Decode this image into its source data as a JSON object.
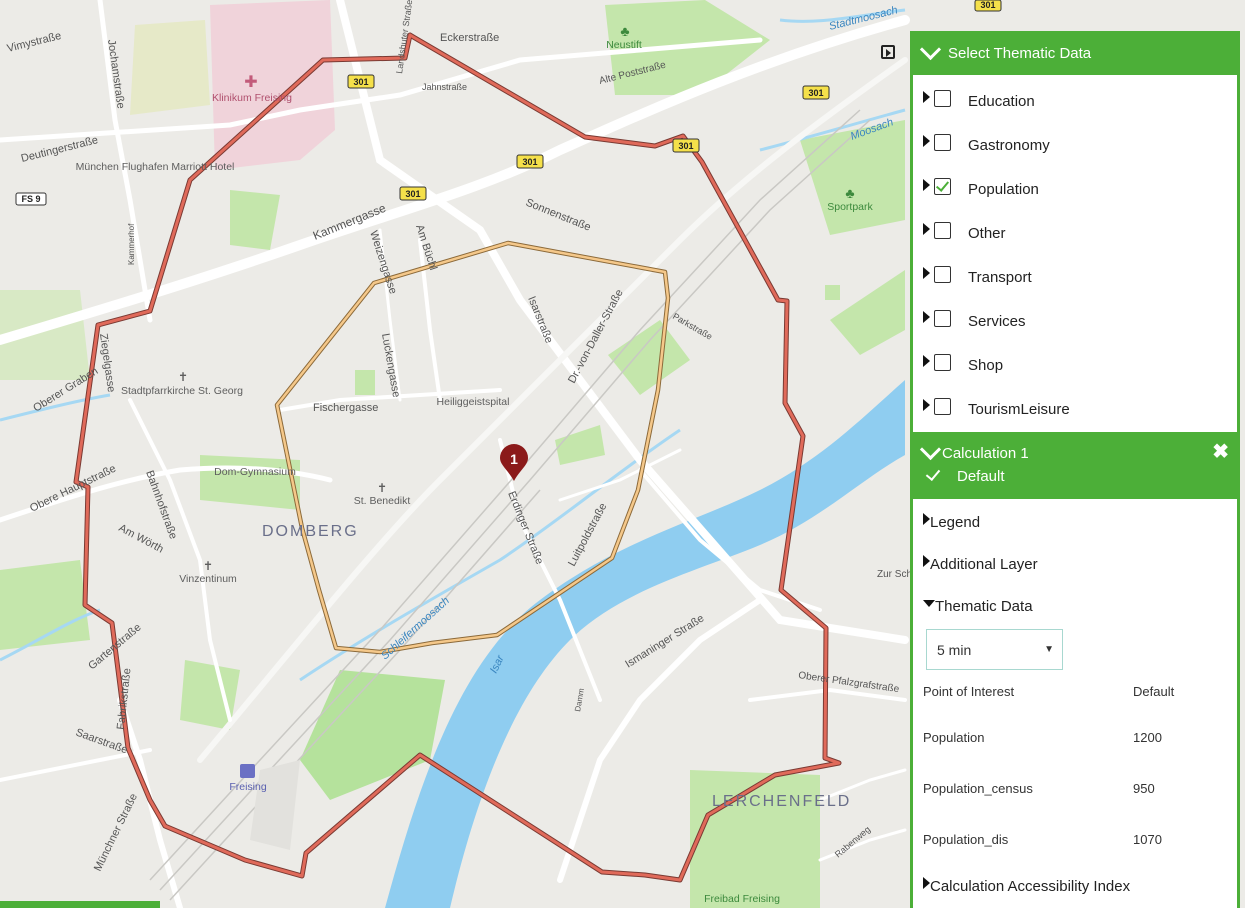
{
  "map": {
    "street_labels": [
      "Vimystraße",
      "Jochamstraße",
      "Deutingerstraße",
      "Kammergasse",
      "Weizengasse",
      "Am Büchl",
      "Sonnenstraße",
      "Isarstraße",
      "Dr.-von-Daller-Straße",
      "Parkstraße",
      "Luckengasse",
      "Fischergasse",
      "Erdinger Straße",
      "Luitpoldstraße",
      "Schleifermoosach",
      "Ziegelgasse",
      "Oberer Graben",
      "Obere Hauptstraße",
      "Bahnhofstraße",
      "Am Wörth",
      "Gartenstraße",
      "Fabrikstraße",
      "Saarstraße",
      "Münchner Straße",
      "Ismaninger Straße",
      "Oberer Pfalzgrafstraße",
      "Rabenweg",
      "Eckerstraße",
      "Jahnstraße",
      "Alte Poststraße",
      "Landshuter Straße",
      "Kammerhof",
      "Damm",
      "Isar",
      "Stadtmoosach",
      "Moosach",
      "Zur Schleife"
    ],
    "poi_labels": [
      "Klinikum Freising",
      "München Flughafen Marriott Hotel",
      "Neustift",
      "Sportpark",
      "Stadtpfarrkirche St. Georg",
      "Heiliggeistspital",
      "Dom-Gymnasium",
      "St. Benedikt",
      "Vinzentinum",
      "Freising",
      "Freibad Freising"
    ],
    "area_labels": [
      "DOMBERG",
      "LERCHENFELD"
    ],
    "road_badges": [
      "301",
      "301",
      "301",
      "301",
      "301",
      "301",
      "FS 9"
    ],
    "marker_number": "1",
    "colors": {
      "isochrone_outer": "#d9685a",
      "isochrone_inner": "#f2c180",
      "river": "#8fcdf0",
      "park": "#b9e5a0",
      "marker": "#8b1a1a"
    }
  },
  "panel": {
    "header_title": "Select Thematic Data",
    "thematic_items": [
      {
        "label": "Education",
        "checked": false
      },
      {
        "label": "Gastronomy",
        "checked": false
      },
      {
        "label": "Population",
        "checked": true
      },
      {
        "label": "Other",
        "checked": false
      },
      {
        "label": "Transport",
        "checked": false
      },
      {
        "label": "Services",
        "checked": false
      },
      {
        "label": "Shop",
        "checked": false
      },
      {
        "label": "TourismLeisure",
        "checked": false
      }
    ],
    "calculation": {
      "title": "Calculation 1",
      "subtitle": "Default",
      "sections": {
        "legend": "Legend",
        "additional_layer": "Additional Layer",
        "thematic_data": "Thematic Data",
        "accessibility": "Calculation Accessibility Index"
      },
      "time_select": "5 min",
      "table": {
        "headers": [
          "Point of Interest",
          "Default"
        ],
        "rows": [
          [
            "Population",
            "1200"
          ],
          [
            "Population_census",
            "950"
          ],
          [
            "Population_dis",
            "1070"
          ]
        ]
      }
    }
  }
}
